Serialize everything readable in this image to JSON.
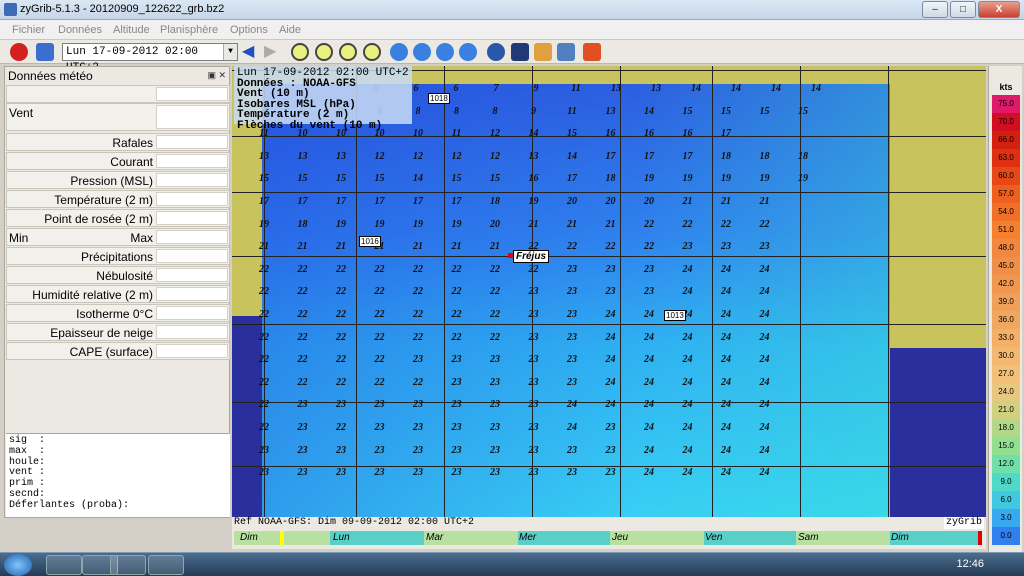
{
  "window": {
    "title": "zyGrib-5.1.3 - 20120909_122622_grb.bz2",
    "min": "–",
    "max": "□",
    "close": "X"
  },
  "menu": [
    "Fichier",
    "Données",
    "Altitude",
    "Planisphère",
    "Options",
    "Aide"
  ],
  "toolbar": {
    "date": "Lun 17-09-2012 02:00 UTC+2"
  },
  "panel": {
    "title": "Données météo",
    "rows": [
      "Vent",
      "Rafales",
      "Courant",
      "Pression (MSL)",
      "Température (2 m)",
      "Point de rosée (2 m)",
      "Min",
      "Max",
      "Précipitations",
      "Nébulosité",
      "Humidité relative (2 m)",
      "Isotherme 0°C",
      "Epaisseur de neige",
      "CAPE (surface)"
    ],
    "info": "sig  :\nmax  :\nhoule:\nvent :\nprim :\nsecnd:\nDéferlantes (proba):"
  },
  "map": {
    "header": "Lun 17-09-2012 02:00 UTC+2",
    "legend": [
      "Données : NOAA-GFS",
      "Vent (10 m)",
      "Isobares MSL (hPa)",
      "Température (2 m)",
      "Flèches du vent (10 m)"
    ],
    "city": "Fréjus",
    "isobars": [
      "1018",
      "1016",
      "1013"
    ],
    "wind_rows": [
      [
        "6",
        "6",
        "6",
        "7",
        "9",
        "11",
        "13",
        "13",
        "14",
        "14",
        "14",
        "14"
      ],
      [
        "9",
        "9",
        "9",
        "8",
        "8",
        "8",
        "8",
        "9",
        "11",
        "13",
        "14",
        "15",
        "15",
        "15",
        "15"
      ],
      [
        "11",
        "10",
        "10",
        "10",
        "10",
        "11",
        "12",
        "14",
        "15",
        "16",
        "16",
        "16",
        "17"
      ],
      [
        "13",
        "13",
        "13",
        "12",
        "12",
        "12",
        "12",
        "13",
        "14",
        "17",
        "17",
        "17",
        "18",
        "18",
        "18"
      ],
      [
        "15",
        "15",
        "15",
        "15",
        "14",
        "15",
        "15",
        "16",
        "17",
        "18",
        "19",
        "19",
        "19",
        "19",
        "19"
      ],
      [
        "17",
        "17",
        "17",
        "17",
        "17",
        "17",
        "18",
        "19",
        "20",
        "20",
        "20",
        "21",
        "21",
        "21"
      ],
      [
        "19",
        "18",
        "19",
        "19",
        "19",
        "19",
        "20",
        "21",
        "21",
        "21",
        "22",
        "22",
        "22",
        "22"
      ],
      [
        "21",
        "21",
        "21",
        "21",
        "21",
        "21",
        "21",
        "22",
        "22",
        "22",
        "22",
        "23",
        "23",
        "23"
      ],
      [
        "22",
        "22",
        "22",
        "22",
        "22",
        "22",
        "22",
        "22",
        "23",
        "23",
        "23",
        "24",
        "24",
        "24"
      ],
      [
        "22",
        "22",
        "22",
        "22",
        "22",
        "22",
        "22",
        "23",
        "23",
        "23",
        "23",
        "24",
        "24",
        "24"
      ],
      [
        "22",
        "22",
        "22",
        "22",
        "22",
        "22",
        "22",
        "23",
        "23",
        "24",
        "24",
        "24",
        "24",
        "24"
      ],
      [
        "22",
        "22",
        "22",
        "22",
        "22",
        "22",
        "22",
        "23",
        "23",
        "24",
        "24",
        "24",
        "24",
        "24"
      ],
      [
        "22",
        "22",
        "22",
        "22",
        "23",
        "23",
        "23",
        "23",
        "23",
        "24",
        "24",
        "24",
        "24",
        "24"
      ],
      [
        "22",
        "22",
        "22",
        "22",
        "22",
        "23",
        "23",
        "23",
        "23",
        "24",
        "24",
        "24",
        "24",
        "24"
      ],
      [
        "22",
        "23",
        "23",
        "23",
        "23",
        "23",
        "23",
        "23",
        "24",
        "24",
        "24",
        "24",
        "24",
        "24"
      ],
      [
        "22",
        "23",
        "22",
        "23",
        "23",
        "23",
        "23",
        "23",
        "24",
        "23",
        "24",
        "24",
        "24",
        "24"
      ],
      [
        "23",
        "23",
        "23",
        "23",
        "23",
        "23",
        "23",
        "23",
        "23",
        "23",
        "24",
        "24",
        "24",
        "24"
      ],
      [
        "23",
        "23",
        "23",
        "23",
        "23",
        "23",
        "23",
        "23",
        "23",
        "23",
        "24",
        "24",
        "24",
        "24"
      ]
    ]
  },
  "footer": {
    "ref": "Ref NOAA-GFS: Dim 09-09-2012 02:00 UTC+2",
    "brand": "zyGrib"
  },
  "timeline": [
    "Dim",
    "Lun",
    "Mar",
    "Mer",
    "Jeu",
    "Ven",
    "Sam",
    "Dim"
  ],
  "scale": {
    "unit": "kts",
    "values": [
      "75.0",
      "70.0",
      "66.0",
      "63.0",
      "60.0",
      "57.0",
      "54.0",
      "51.0",
      "48.0",
      "45.0",
      "42.0",
      "39.0",
      "36.0",
      "33.0",
      "30.0",
      "27.0",
      "24.0",
      "21.0",
      "18.0",
      "15.0",
      "12.0",
      "9.0",
      "6.0",
      "3.0",
      "0.0"
    ],
    "colors": [
      "#e01a6a",
      "#d01020",
      "#d42010",
      "#e03010",
      "#e84818",
      "#ee6020",
      "#f07028",
      "#f48030",
      "#f08840",
      "#f09048",
      "#f09850",
      "#f0a058",
      "#f0a860",
      "#f4b068",
      "#f4b870",
      "#f2c078",
      "#e8c880",
      "#d0d080",
      "#b0d888",
      "#90e090",
      "#70e0a8",
      "#50d8c8",
      "#40c8e0",
      "#38a8f0",
      "#3080f0"
    ]
  },
  "taskbar": {
    "clock": "12:46"
  }
}
